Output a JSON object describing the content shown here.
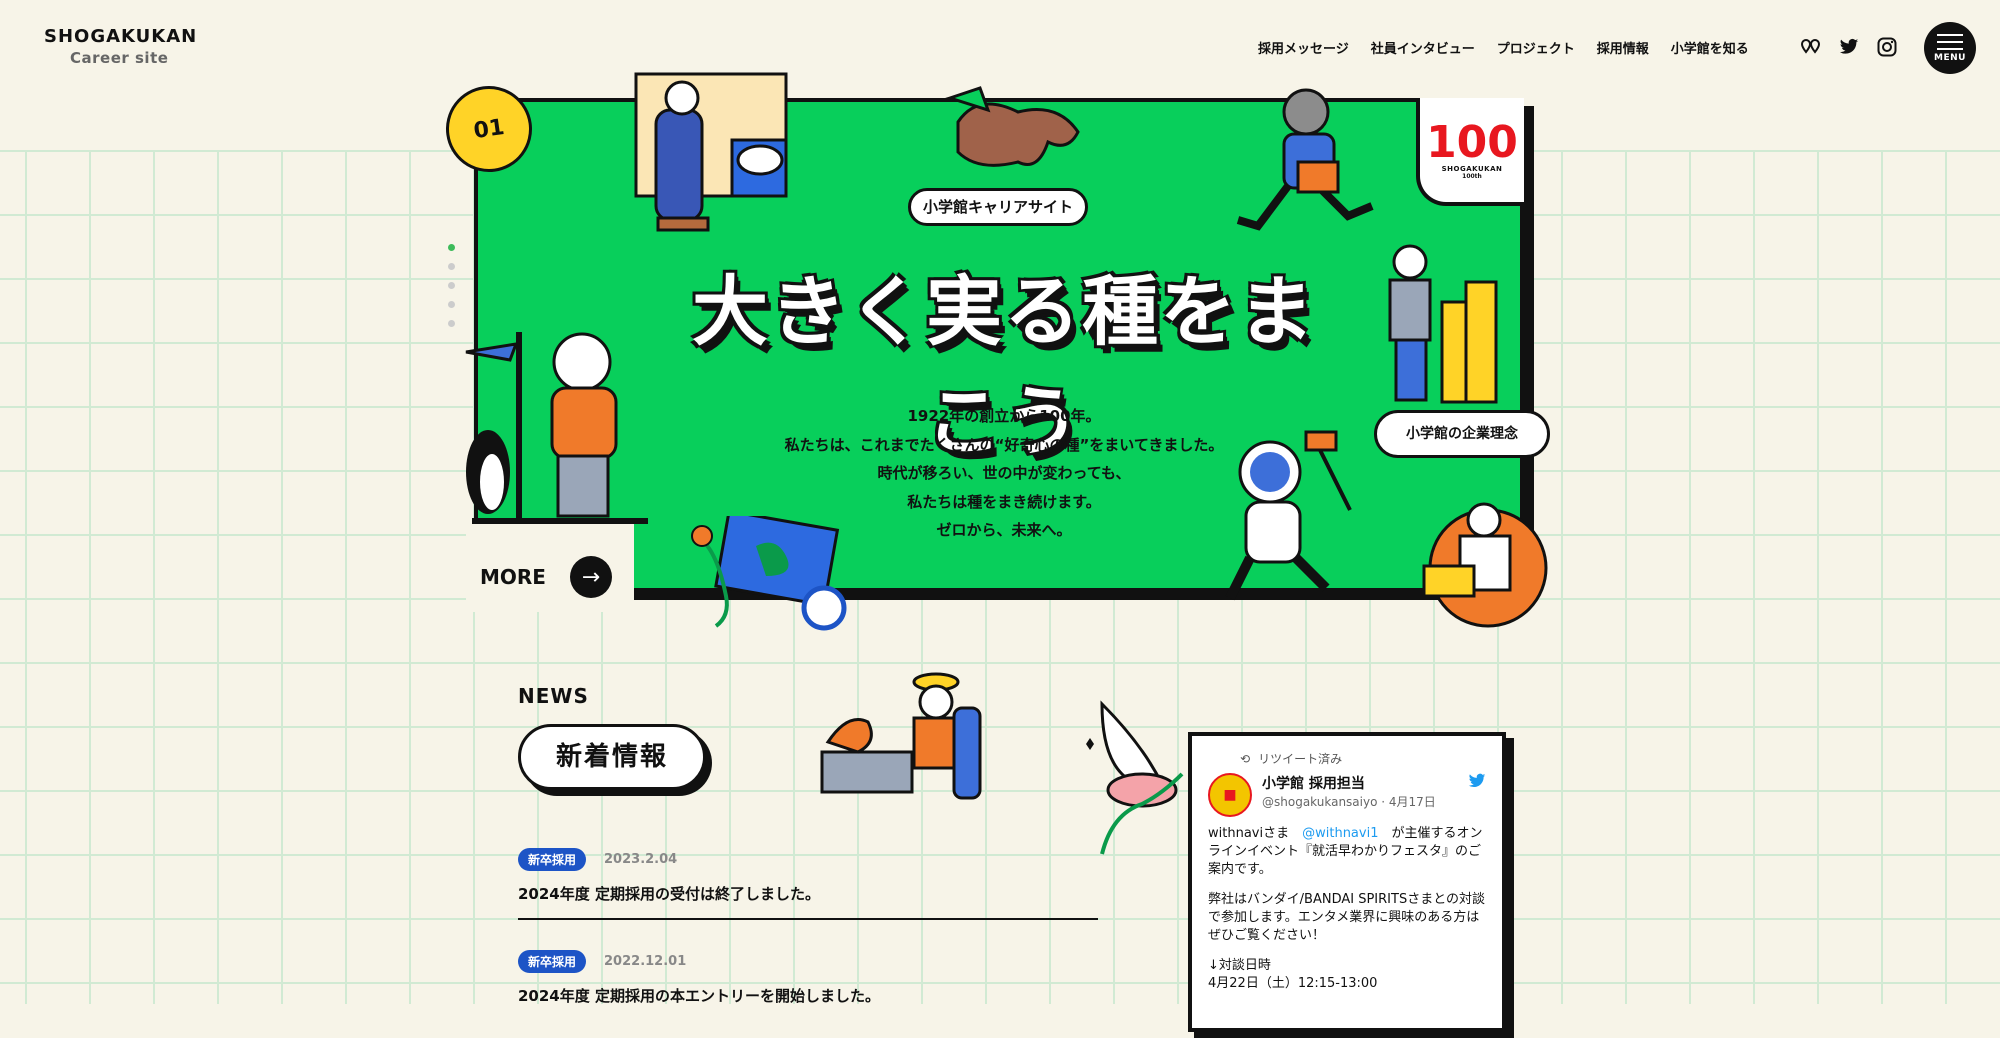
{
  "header": {
    "logo_name": "SHOGAKUKAN",
    "logo_sub": "Career site",
    "nav": [
      "採用メッセージ",
      "社員インタビュー",
      "プロジェクト",
      "採用情報",
      "小学館を知る"
    ],
    "social_icons": [
      "map-pin-icon",
      "twitter-icon",
      "instagram-icon"
    ],
    "menu_label": "MENU"
  },
  "hero": {
    "badge": "01",
    "label": "小学館キャリアサイト",
    "title": "大きく実る種をまこう",
    "lines": [
      "1922年の創立から100年。",
      "私たちは、これまでたくさんの“好奇心の種”をまいてきました。",
      "時代が移ろい、世の中が変わっても、",
      "私たちは種をまき続けます。",
      "ゼロから、未来へ。"
    ],
    "more_label": "MORE",
    "anniversary": {
      "number": "100",
      "text1": "SHOGAKUKAN",
      "text2": "100th"
    },
    "philosophy_label": "小学館の企業理念",
    "slide_dots": 5,
    "active_dot": 0
  },
  "news": {
    "label": "NEWS",
    "heading": "新着情報",
    "items": [
      {
        "tag": "新卒採用",
        "date": "2023.2.04",
        "title": "2024年度 定期採用の受付は終了しました。"
      },
      {
        "tag": "新卒採用",
        "date": "2022.12.01",
        "title": "2024年度 定期採用の本エントリーを開始しました。"
      }
    ]
  },
  "tweet": {
    "retweet": "リツイート済み",
    "name": "小学館 採用担当",
    "handle": "@shogakukansaiyo · 4月17日",
    "p1_pre": "withnaviさま",
    "mention": "@withnavi1",
    "p1_post": "が主催するオンラインイベント『就活早わかりフェスタ』のご案内です。",
    "p2": "弊社はバンダイ/BANDAI SPIRITSさまとの対談で参加します。エンタメ業界に興味のある方はぜひご覧ください！",
    "p3": "↓対談日時",
    "p4": "4月22日（土）12:15-13:00"
  },
  "colors": {
    "hero_green": "#08cf5b",
    "accent_yellow": "#ffd327",
    "tag_blue": "#1d54c6",
    "brand_red": "#e8171f"
  }
}
